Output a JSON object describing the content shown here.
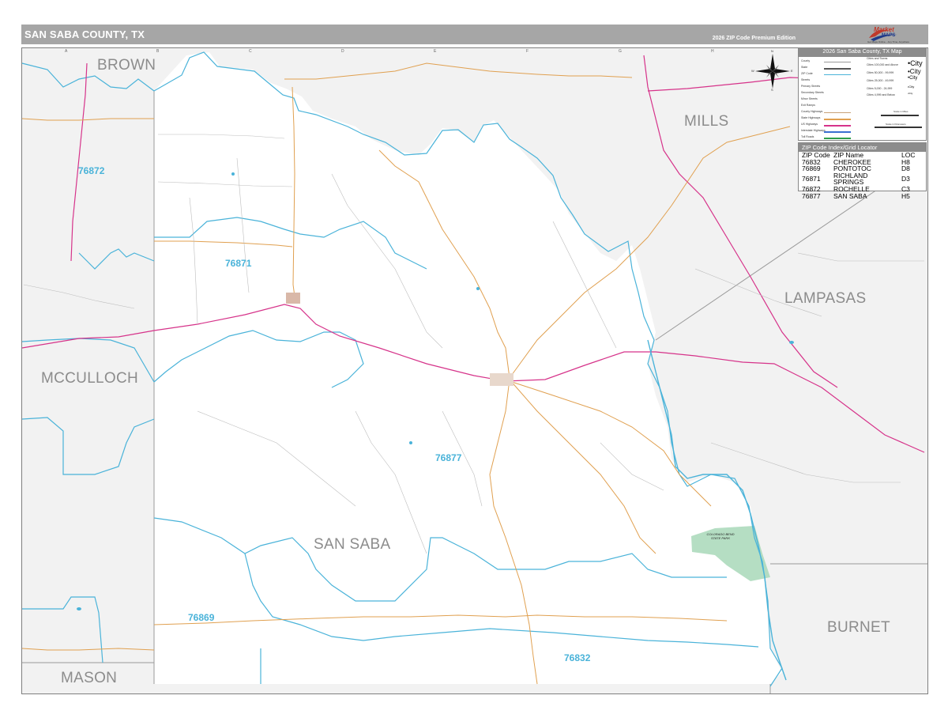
{
  "header": {
    "title": "SAN SABA COUNTY, TX",
    "edition": "2026 ZIP Code Premium Edition"
  },
  "logo": {
    "text": "Market",
    "sub": "MAPS",
    "tagline": "Get Maps Online... Any Time, Anywhere",
    "brand_color": "#c0392b",
    "accent_color": "#1f3a8a"
  },
  "colors": {
    "county_fill": "#f2f2f2",
    "county_focus_fill": "#ffffff",
    "zip_boundary": "#4ab3d9",
    "county_boundary": "#8c8c8c",
    "us_highway": "#d6338a",
    "state_highway": "#e0a050",
    "water": "#4ab3d9",
    "park": "#a8d8b9"
  },
  "counties": {
    "brown": "BROWN",
    "mills": "MILLS",
    "lampasas": "LAMPASAS",
    "mcculloch": "MCCULLOCH",
    "san_saba": "SAN SABA",
    "mason": "MASON",
    "burnet": "BURNET"
  },
  "zip_labels": {
    "z76872": "76872",
    "z76871": "76871",
    "z76877": "76877",
    "z76869": "76869",
    "z76832": "76832"
  },
  "legend": {
    "title": "2026 San Saba County, TX Map",
    "rows": [
      "County",
      "State",
      "ZIP Code",
      "Streets",
      "Primary Streets",
      "Secondary Streets",
      "Minor Streets",
      "Exit Ramps",
      "County Highways",
      "State Highways",
      "US Highways",
      "Interstate Highways",
      "Toll Roads"
    ],
    "pop_header": "Cities and Towns",
    "pops": [
      "Cities 100,000 and Above",
      "Cities 50,000 - 99,999",
      "Cities 25,000 - 49,999",
      "Cities 5,000 - 24,999",
      "Cities 4,999 and Below"
    ],
    "city_samples": [
      "•City",
      "•City",
      "•City",
      "•City",
      "•City"
    ],
    "scale_miles": "Scale in Miles",
    "scale_km": "Scale in Kilometers"
  },
  "zip_index": {
    "title": "ZIP Code Index/Grid Locator",
    "columns": [
      "ZIP Code",
      "ZIP Name",
      "LOC"
    ],
    "rows": [
      [
        "76832",
        "CHEROKEE",
        "H8"
      ],
      [
        "76869",
        "PONTOTOC",
        "D8"
      ],
      [
        "76871",
        "RICHLAND SPRINGS",
        "D3"
      ],
      [
        "76872",
        "ROCHELLE",
        "C3"
      ],
      [
        "76877",
        "SAN SABA",
        "H5"
      ]
    ]
  },
  "compass": {
    "n": "N",
    "s": "S",
    "e": "E",
    "w": "W"
  },
  "park": {
    "name": "COLORADO BEND STATE PARK"
  },
  "grid_letters": [
    "A",
    "B",
    "C",
    "D",
    "E",
    "F",
    "G",
    "H",
    "I",
    "J",
    "K"
  ]
}
